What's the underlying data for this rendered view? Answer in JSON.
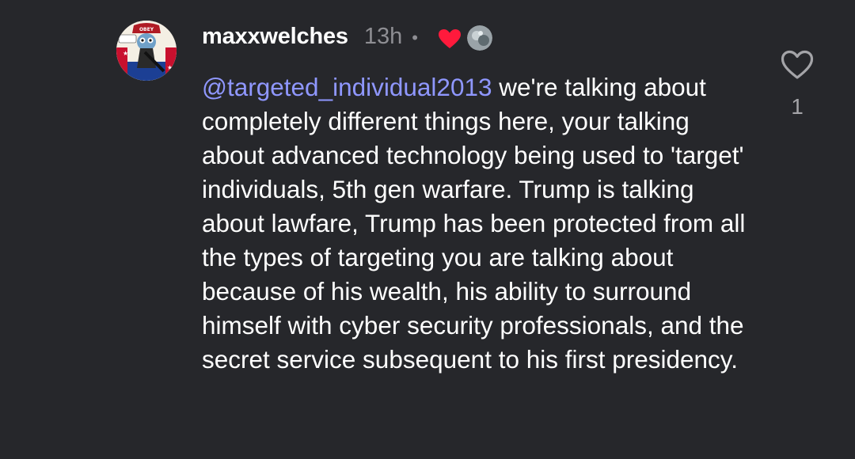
{
  "comment": {
    "username": "maxxwelches",
    "time": "13h",
    "separator": "•",
    "avatar_label": "OBEY",
    "mention": "@targeted_individual2013",
    "text": " we're talking about completely different things here, your talking about advanced technology being used to 'target' individuals, 5th gen warfare. Trump is talking about lawfare, Trump has been protected from all the types of targeting you are talking about because of his wealth, his ability to surround himself with cyber security professionals, and the secret service subsequent to his first presidency."
  },
  "like": {
    "count": "1"
  },
  "icons": {
    "like": "heart-outline-icon",
    "author_liked": "heart-filled-icon"
  },
  "colors": {
    "background": "#26272b",
    "mention": "#8f97ff",
    "heart": "#ff1a3c",
    "muted": "#8e8e93"
  }
}
